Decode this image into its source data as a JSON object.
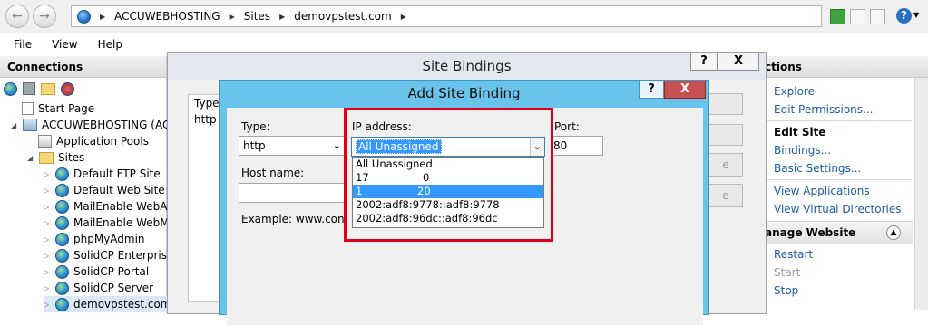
{
  "address_bar": {
    "crumbs": [
      "ACCUWEBHOSTING",
      "Sites",
      "demovpstest.com"
    ]
  },
  "menu": [
    "File",
    "View",
    "Help"
  ],
  "connections": {
    "title": "Connections",
    "tree": [
      {
        "label": "Start Page"
      },
      {
        "label": "ACCUWEBHOSTING (ACC"
      },
      {
        "label": "Application Pools"
      },
      {
        "label": "Sites"
      },
      {
        "label": "Default FTP Site"
      },
      {
        "label": "Default Web Site"
      },
      {
        "label": "MailEnable WebAd"
      },
      {
        "label": "MailEnable WebMa"
      },
      {
        "label": "phpMyAdmin"
      },
      {
        "label": "SolidCP Enterprise"
      },
      {
        "label": "SolidCP Portal"
      },
      {
        "label": "SolidCP Server"
      },
      {
        "label": "demovpstest.com"
      }
    ]
  },
  "actions": {
    "title": "ctions",
    "items": [
      "Explore",
      "Edit Permissions..."
    ],
    "edit_site": "Edit Site",
    "edit_items": [
      "Bindings...",
      "Basic Settings..."
    ],
    "view_items": [
      "View Applications",
      "View Virtual Directories"
    ],
    "manage": "anage Website",
    "manage_items": [
      "Restart",
      "Start",
      "Stop"
    ]
  },
  "site_bindings": {
    "title": "Site Bindings",
    "help": "?",
    "close": "X",
    "col_type": "Type",
    "row_type": "http",
    "btn_partial_1": "e",
    "btn_partial_2": "e"
  },
  "add_site_binding": {
    "title": "Add Site Binding",
    "help": "?",
    "close": "X",
    "type_label": "Type:",
    "type_value": "http",
    "ip_label": "IP address:",
    "ip_value": "All Unassigned",
    "port_label": "Port:",
    "port_value": "80",
    "host_label": "Host name:",
    "example": "Example: www.conto",
    "ip_options": [
      "All Unassigned",
      "17",
      "0",
      "1",
      "20",
      "2002:adf8:9778::adf8:9778",
      "2002:adf8:96dc::adf8:96dc"
    ]
  },
  "colors": {
    "dialog_title_active": "#6ac3ea",
    "highlight": "#3399ff",
    "callout": "#e0001a",
    "link": "#1a5aa8"
  }
}
